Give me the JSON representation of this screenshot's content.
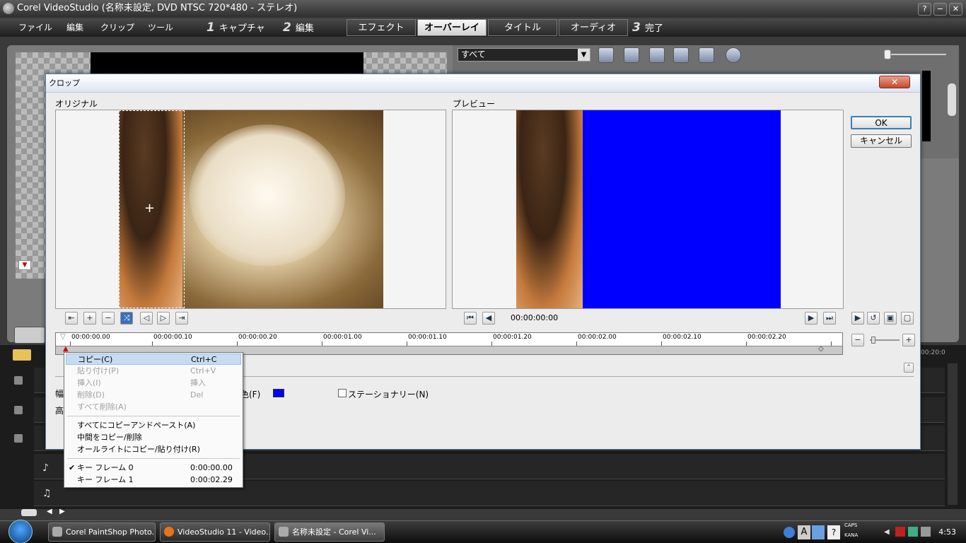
{
  "app": {
    "title": "Corel VideoStudio (名称未設定, DVD NTSC 720*480 - ステレオ)",
    "help_btn": "?",
    "min_btn": "−",
    "close_btn": "✕"
  },
  "menu": {
    "items": [
      "ファイル",
      "編集",
      "クリップ",
      "ツール"
    ]
  },
  "steps": [
    {
      "num": "1",
      "label": "キャプチャ"
    },
    {
      "num": "2",
      "label": "編集"
    },
    {
      "num": "3",
      "label": "完了"
    }
  ],
  "tabs": [
    "エフェクト",
    "オーバーレイ",
    "タイトル",
    "オーディオ"
  ],
  "active_tab": "オーバーレイ",
  "library": {
    "category": "すべて"
  },
  "dialog": {
    "title": "クロップ",
    "close": "✕",
    "original_label": "オリジナル",
    "preview_label": "プレビュー",
    "ok": "OK",
    "cancel": "キャンセル",
    "timecode": "00:00:00:00",
    "ruler_ticks": [
      "00:00:00.00",
      "00:00:00.10",
      "00:00:00.20",
      "00:00:01.00",
      "00:00:01.10",
      "00:00:01.20",
      "00:00:02.00",
      "00:00:02.10",
      "00:00:02.20"
    ],
    "color_label": "色(F)",
    "width_label_partial": "幅",
    "height_label_partial": "高",
    "stationary_label": "ステーショナリー(N)",
    "fill_color": "#0000ff"
  },
  "context_menu": {
    "items": [
      {
        "label": "コピー(C)",
        "shortcut": "Ctrl+C",
        "state": "highlighted"
      },
      {
        "label": "貼り付け(P)",
        "shortcut": "Ctrl+V",
        "state": "disabled"
      },
      {
        "label": "挿入(I)",
        "shortcut": "挿入",
        "state": "disabled"
      },
      {
        "label": "削除(D)",
        "shortcut": "Del",
        "state": "disabled"
      },
      {
        "label": "すべて削除(A)",
        "shortcut": "",
        "state": "disabled"
      },
      {
        "label": "すべてにコピーアンドペースト(A)",
        "shortcut": "",
        "state": "normal"
      },
      {
        "label": "中間をコピー/削除",
        "shortcut": "",
        "state": "normal"
      },
      {
        "label": "オールライトにコピー/貼り付け(R)",
        "shortcut": "",
        "state": "normal"
      },
      {
        "label": "キー フレーム 0",
        "shortcut": "0:00:00.00",
        "state": "checked"
      },
      {
        "label": "キー フレーム 1",
        "shortcut": "0:00:02.29",
        "state": "normal"
      }
    ]
  },
  "timeline": {
    "end_label": "00:20:0"
  },
  "taskbar": {
    "buttons": [
      "Corel PaintShop Photo...",
      "VideoStudio 11 - Video...",
      "名称未設定 - Corel Vi..."
    ],
    "caps": "CAPS",
    "kana": "KANA",
    "clock": "4:53"
  }
}
